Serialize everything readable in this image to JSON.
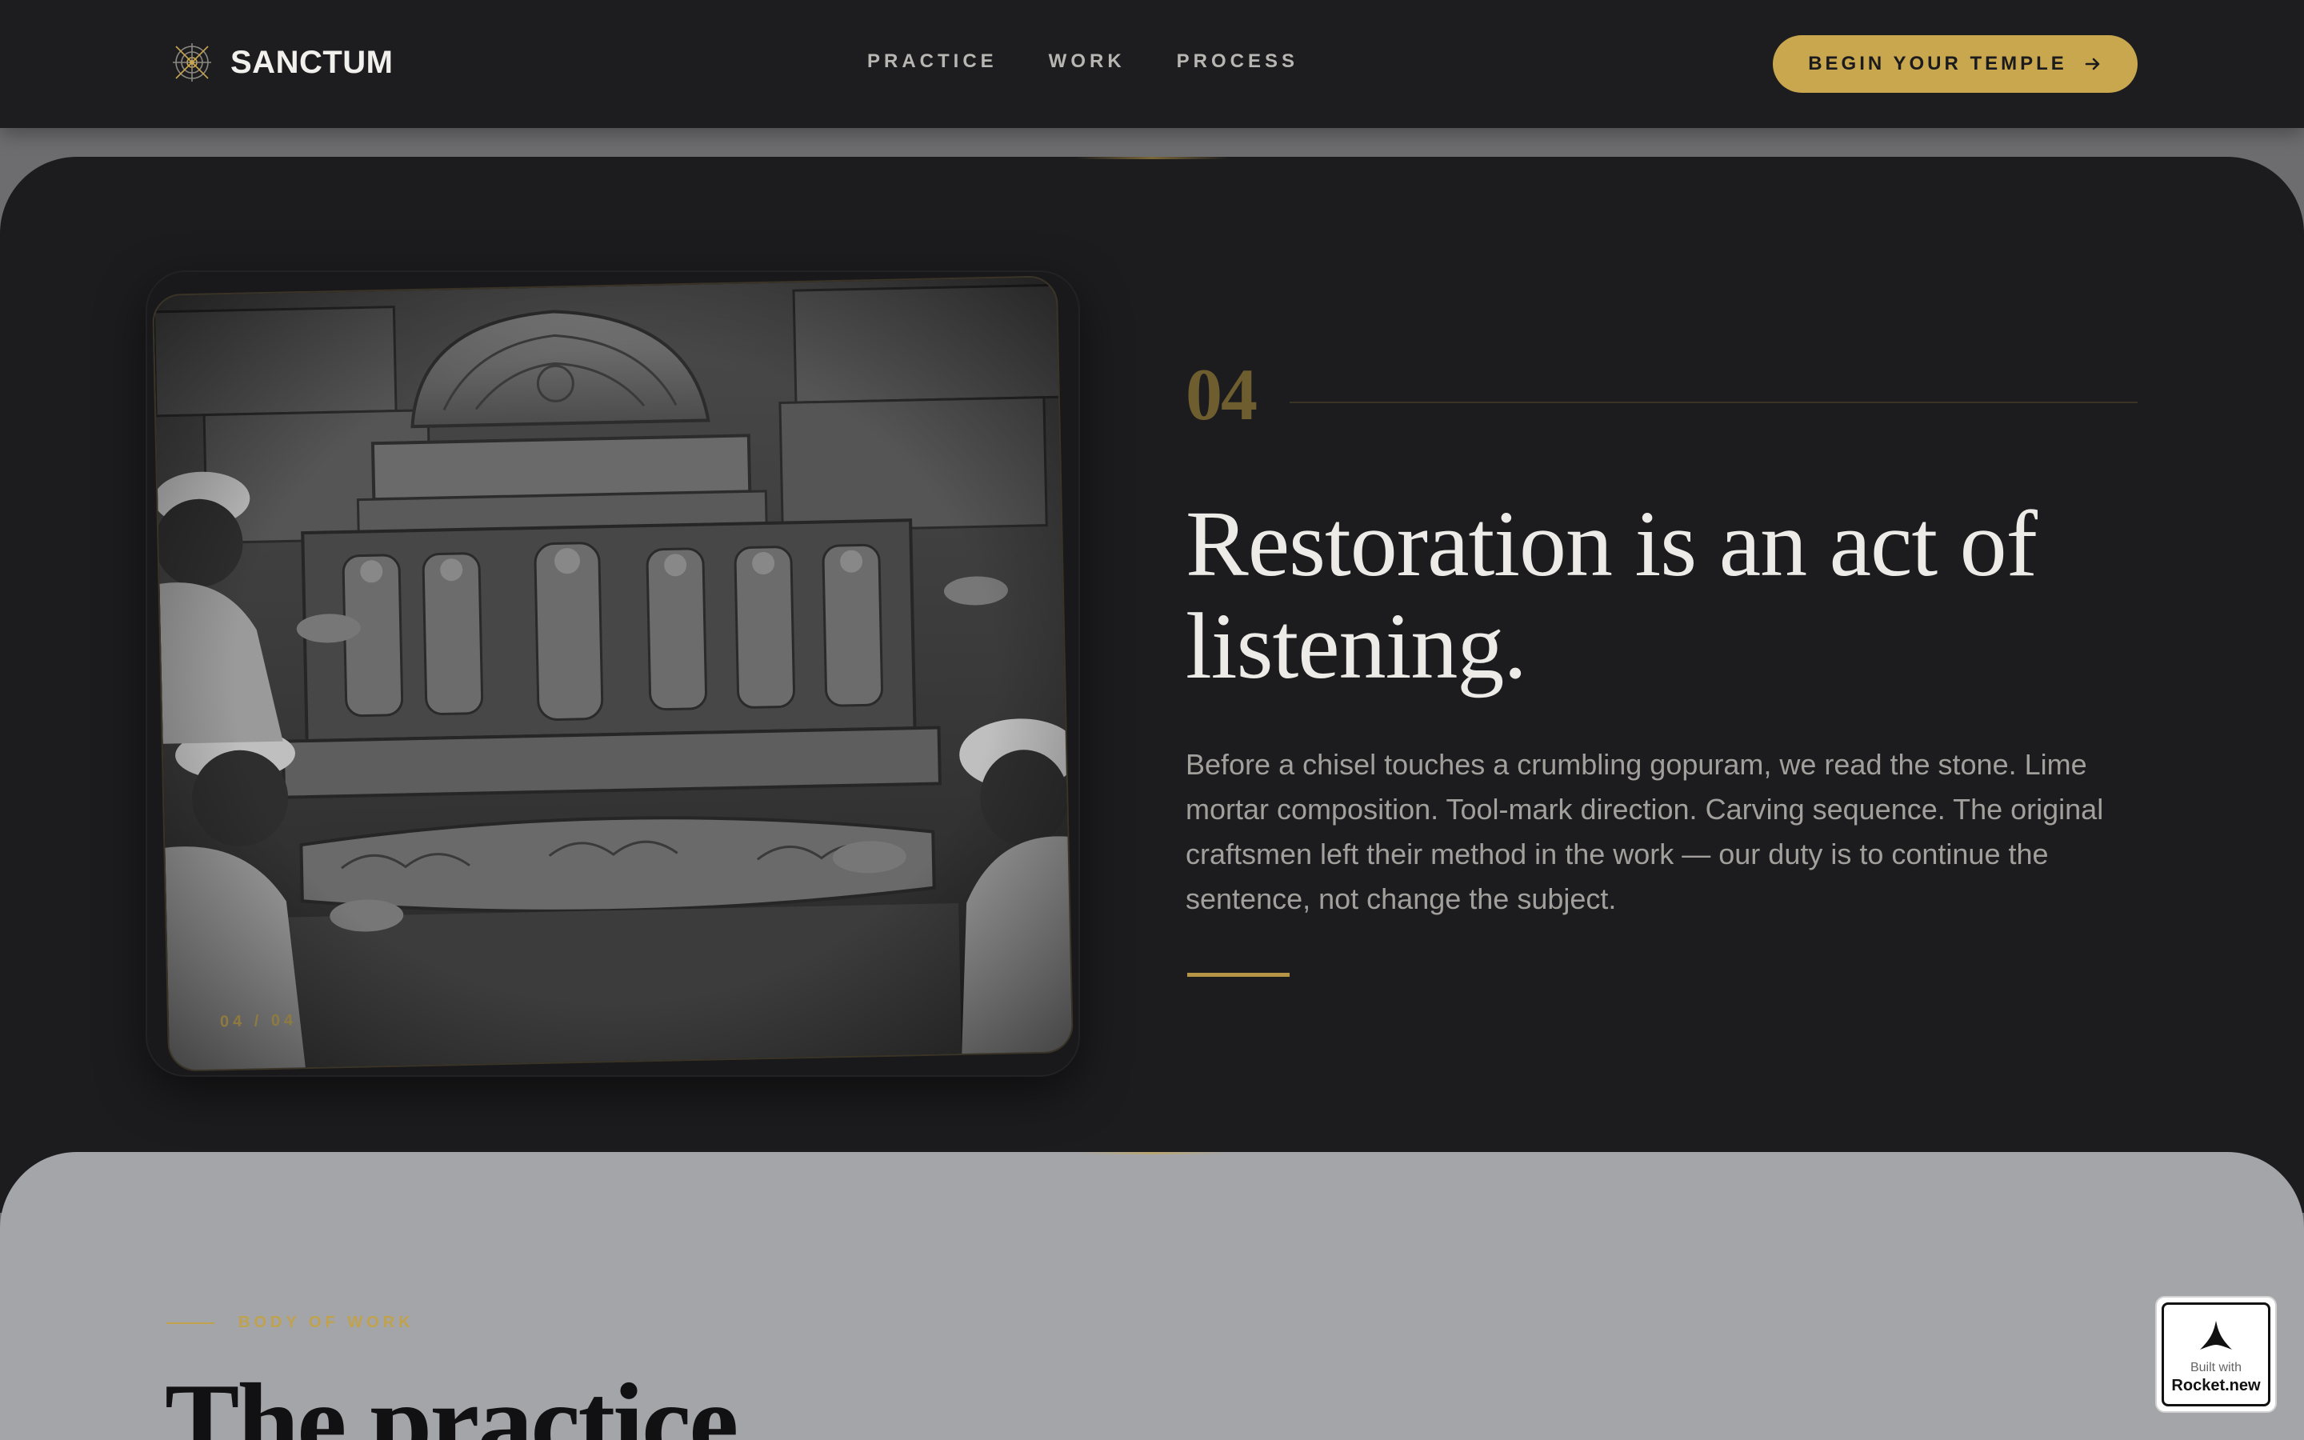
{
  "nav": {
    "brand": "SANCTUM",
    "brand_icon": "mandala-logo-icon",
    "links": [
      {
        "label": "PRACTICE"
      },
      {
        "label": "WORK"
      },
      {
        "label": "PROCESS"
      }
    ],
    "cta_label": "BEGIN YOUR TEMPLE",
    "cta_icon": "arrow-right-icon"
  },
  "feature": {
    "photo_subject": "temple-restoration-photo",
    "counter": "04 / 04",
    "number": "04",
    "headline_line1": "Restoration is an act of",
    "headline_line2": "listening.",
    "body": "Before a chisel touches a crumbling gopuram, we read the stone. Lime mortar composition. Tool-mark direction. Carving sequence. The original craftsmen left their method in the work — our duty is to continue the sentence, not change the subject."
  },
  "practice": {
    "eyebrow": "BODY OF WORK",
    "title": "The practice"
  },
  "badge": {
    "line1": "Built with",
    "line2": "Rocket.new",
    "icon": "rocket-icon"
  },
  "colors": {
    "accent": "#c9a74f",
    "dark_bg": "#1c1c1e",
    "nav_bg": "#1d1d1f",
    "grey_bg": "#a4a5a9",
    "heading_text": "#ecebe7",
    "body_text": "#a2a09c"
  }
}
